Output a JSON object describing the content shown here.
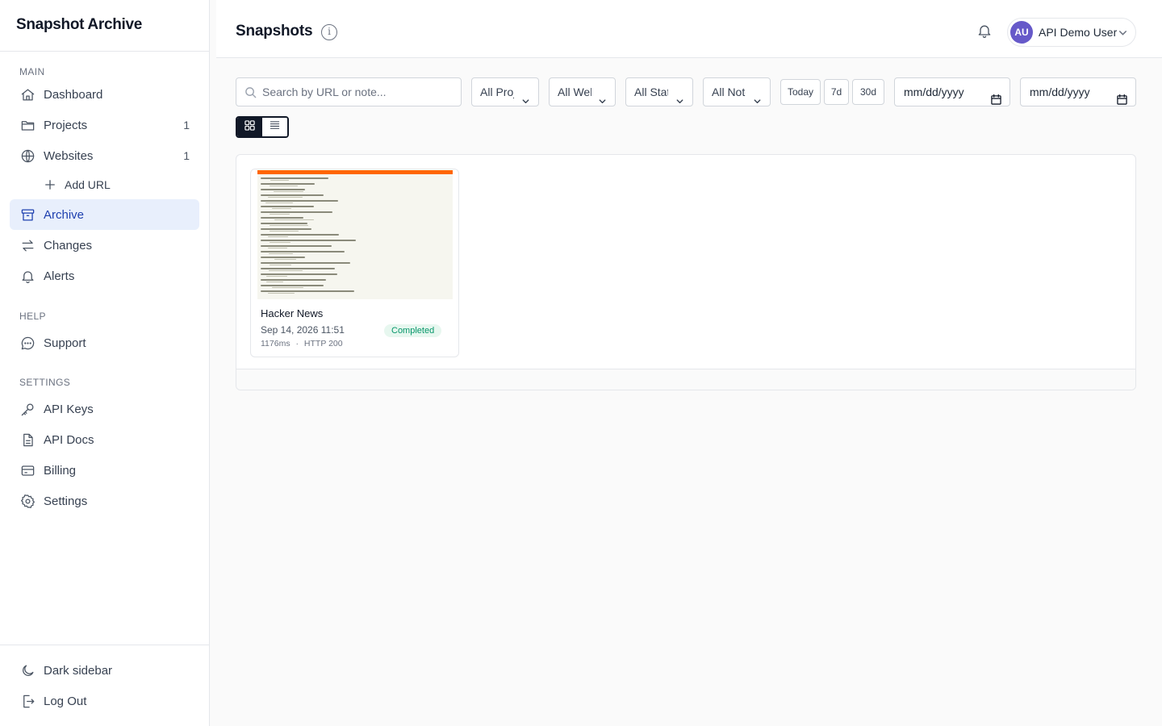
{
  "sidebar": {
    "brand": "Snapshot Archive",
    "sections": {
      "main": "MAIN",
      "help": "HELP",
      "settings": "SETTINGS"
    },
    "items": {
      "dashboard": "Dashboard",
      "projects": "Projects",
      "projects_count": "1",
      "websites": "Websites",
      "websites_count": "1",
      "add_url": "Add URL",
      "archive": "Archive",
      "changes": "Changes",
      "alerts": "Alerts",
      "support": "Support",
      "api_keys": "API Keys",
      "api_docs": "API Docs",
      "billing": "Billing",
      "settings": "Settings",
      "dark_sidebar": "Dark sidebar",
      "log_out": "Log Out"
    },
    "active_item": "archive",
    "accent_color": "#1e40af"
  },
  "header": {
    "title": "Snapshots",
    "info_glyph": "i",
    "user": {
      "initials": "AU",
      "name": "API Demo User",
      "avatar_color": "#6659c9"
    }
  },
  "filters": {
    "search_placeholder": "Search by URL or note...",
    "project": "All Projects",
    "website": "All Websites",
    "status": "All Statuses",
    "notes": "All Notes",
    "quick_ranges": [
      "Today",
      "7d",
      "30d"
    ],
    "date_from": "mm/dd/yyyy",
    "date_to": "mm/dd/yyyy"
  },
  "view": {
    "mode": "grid",
    "options": [
      "grid",
      "list"
    ]
  },
  "snapshots": [
    {
      "title": "Hacker News",
      "date": "Sep 14, 2026 11:51",
      "status": "Completed",
      "duration": "1176ms",
      "http": "HTTP 200",
      "separator": "·",
      "status_color": "#059669"
    }
  ]
}
